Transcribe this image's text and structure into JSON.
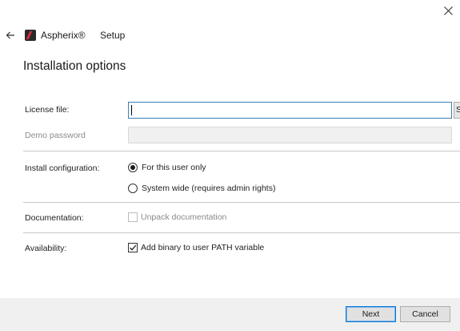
{
  "header": {
    "app_name": "Aspherix®",
    "window_title": "Setup",
    "close_icon": "close-icon",
    "back_icon": "arrow-left-icon"
  },
  "page": {
    "title": "Installation options"
  },
  "license": {
    "label": "License file:",
    "value": "",
    "browse_label": "S"
  },
  "demo": {
    "label": "Demo password",
    "value": ""
  },
  "install_config": {
    "label": "Install configuration:",
    "options": [
      {
        "label": "For this user only",
        "selected": true
      },
      {
        "label": "System wide (requires admin rights)",
        "selected": false
      }
    ]
  },
  "documentation": {
    "label": "Documentation:",
    "option_label": "Unpack documentation",
    "checked": false,
    "enabled": false
  },
  "availability": {
    "label": "Availability:",
    "option_label": "Add binary to user PATH variable",
    "checked": true
  },
  "footer": {
    "next_label": "Next",
    "cancel_label": "Cancel"
  },
  "colors": {
    "focus_border": "#3c7fb1",
    "primary_button_border": "#0078d7",
    "logo_red": "#d9303a"
  }
}
